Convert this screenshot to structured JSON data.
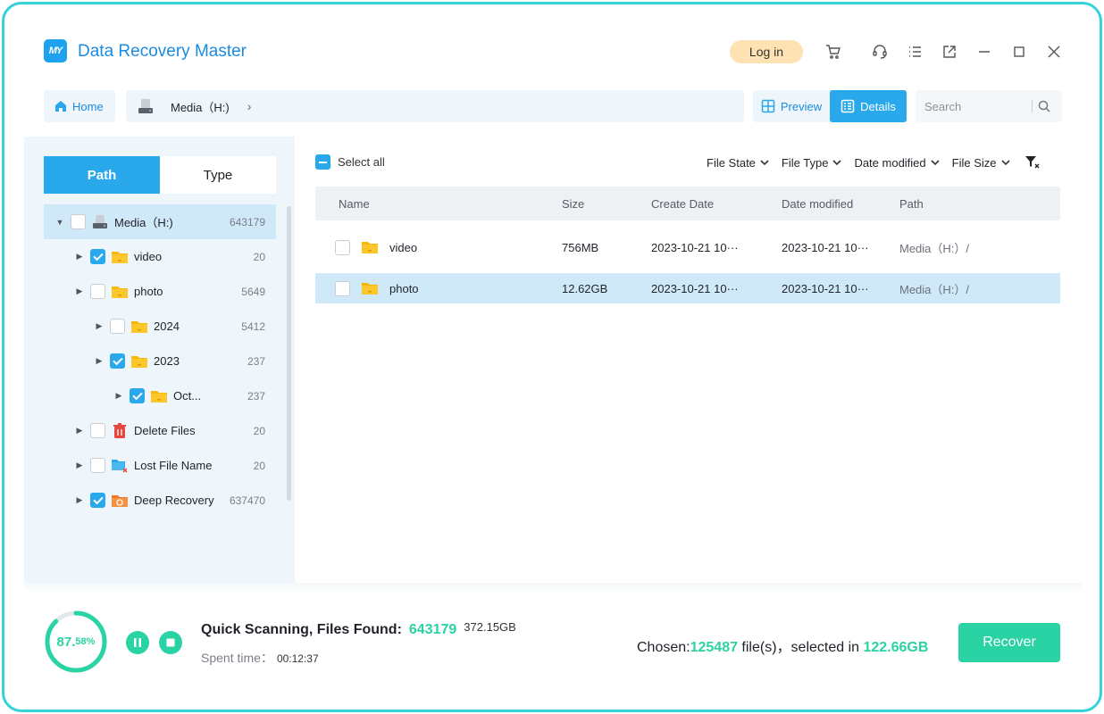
{
  "app": {
    "title": "Data Recovery Master",
    "logo_text": "MY"
  },
  "titlebar": {
    "login_label": "Log in"
  },
  "nav": {
    "home_label": "Home",
    "crumb_label": "Media（H:)"
  },
  "view": {
    "preview_label": "Preview",
    "details_label": "Details",
    "active": "Details"
  },
  "search": {
    "placeholder": "Search"
  },
  "left_tabs": {
    "path_label": "Path",
    "type_label": "Type",
    "active": "Path"
  },
  "tree": [
    {
      "label": "Media（H:)",
      "count": "643179",
      "checked": false,
      "icon": "drive-icon",
      "level": 0,
      "expanded": true,
      "selected": true
    },
    {
      "label": "video",
      "count": "20",
      "checked": true,
      "icon": "folder-icon",
      "level": 1
    },
    {
      "label": "photo",
      "count": "5649",
      "checked": false,
      "icon": "folder-icon",
      "level": 1
    },
    {
      "label": "2024",
      "count": "5412",
      "checked": false,
      "icon": "folder-icon",
      "level": 2
    },
    {
      "label": "2023",
      "count": "237",
      "checked": true,
      "icon": "folder-icon",
      "level": 2
    },
    {
      "label": "Oct...",
      "count": "237",
      "checked": true,
      "icon": "folder-icon",
      "level": 3
    },
    {
      "label": "Delete Files",
      "count": "20",
      "checked": false,
      "icon": "trash-icon",
      "level": 1
    },
    {
      "label": "Lost File Name",
      "count": "20",
      "checked": false,
      "icon": "lost-file-icon",
      "level": 1
    },
    {
      "label": "Deep Recovery",
      "count": "637470",
      "checked": true,
      "icon": "deep-recovery-icon",
      "level": 1
    }
  ],
  "toolbar": {
    "select_all_label": "Select all",
    "filters": [
      "File State",
      "File Type",
      "Date modified",
      "File Size"
    ]
  },
  "table": {
    "headers": [
      "Name",
      "Size",
      "Create Date",
      "Date modified",
      "Path"
    ],
    "rows": [
      {
        "name": "video",
        "size": "756MB",
        "create": "2023-10-21 10···",
        "modified": "2023-10-21 10···",
        "path": "Media（H:）/",
        "selected": false
      },
      {
        "name": "photo",
        "size": "12.62GB",
        "create": "2023-10-21 10···",
        "modified": "2023-10-21 10···",
        "path": "Media（H:）/",
        "selected": true
      }
    ]
  },
  "footer": {
    "progress_main": "87.",
    "progress_small": "58%",
    "progress_value": 87.58,
    "scan_label": "Quick Scanning, Files Found:",
    "scan_count": "643179",
    "scan_size": "372.15GB",
    "spent_label": "Spent time：",
    "spent_value": "00:12:37",
    "chosen_label": "Chosen:",
    "chosen_count": "125487",
    "chosen_mid": " file(s)，selected in ",
    "chosen_size": "122.66GB",
    "recover_label": "Recover"
  },
  "colors": {
    "accent": "#29a8ec",
    "green": "#2ad3a3",
    "border": "#35d3d9",
    "login": "#ffe2b3"
  }
}
